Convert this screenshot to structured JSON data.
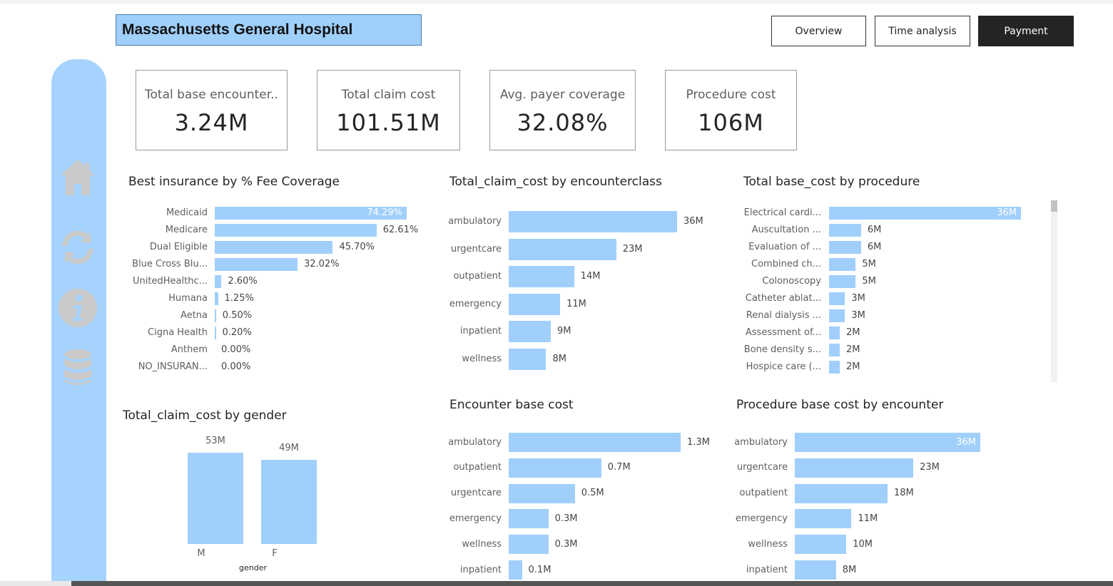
{
  "header": {
    "title": "Massachusetts General Hospital",
    "nav": [
      {
        "label": "Overview",
        "active": false
      },
      {
        "label": "Time analysis",
        "active": false
      },
      {
        "label": "Payment",
        "active": true
      }
    ]
  },
  "sidebar": {
    "icons": [
      "home-icon",
      "refresh-icon",
      "info-icon",
      "database-icon"
    ],
    "color": "#a6d3fd"
  },
  "kpis": [
    {
      "label": "Total base encounter..",
      "value": "3.24M"
    },
    {
      "label": "Total claim cost",
      "value": "101.51M"
    },
    {
      "label": "Avg. payer coverage",
      "value": "32.08%"
    },
    {
      "label": "Procedure cost",
      "value": "106M"
    }
  ],
  "colors": {
    "bar": "#a0cffc",
    "accent": "#9fcffb"
  },
  "chart_data": [
    {
      "id": "insurance",
      "type": "bar",
      "orientation": "horizontal",
      "title": "Best insurance by % Fee Coverage",
      "categories": [
        "Medicaid",
        "Medicare",
        "Dual Eligible",
        "Blue Cross Blu...",
        "UnitedHealthc...",
        "Humana",
        "Aetna",
        "Cigna Health",
        "Anthem",
        "NO_INSURAN..."
      ],
      "values": [
        74.29,
        62.61,
        45.7,
        32.02,
        2.6,
        1.25,
        0.5,
        0.2,
        0.0,
        0.0
      ],
      "labels": [
        "74.29%",
        "62.61%",
        "45.70%",
        "32.02%",
        "2.60%",
        "1.25%",
        "0.50%",
        "0.20%",
        "0.00%",
        "0.00%"
      ],
      "xlim": [
        0,
        74.29
      ]
    },
    {
      "id": "encounterclass",
      "type": "bar",
      "orientation": "horizontal",
      "title": "Total_claim_cost by encounterclass",
      "categories": [
        "ambulatory",
        "urgentcare",
        "outpatient",
        "emergency",
        "inpatient",
        "wellness"
      ],
      "values": [
        36,
        23,
        14,
        11,
        9,
        8
      ],
      "labels": [
        "36M",
        "23M",
        "14M",
        "11M",
        "9M",
        "8M"
      ],
      "xlim": [
        0,
        36
      ]
    },
    {
      "id": "procedure",
      "type": "bar",
      "orientation": "horizontal",
      "title": "Total base_cost by procedure",
      "categories": [
        "Electrical cardi...",
        "Auscultation ...",
        "Evaluation of ...",
        "Combined ch...",
        "Colonoscopy",
        "Catheter ablat...",
        "Renal dialysis ...",
        "Assessment of...",
        "Bone density s...",
        "Hospice care (..."
      ],
      "values": [
        36,
        6,
        6,
        5,
        5,
        3,
        3,
        2,
        2,
        2
      ],
      "labels": [
        "36M",
        "6M",
        "6M",
        "5M",
        "5M",
        "3M",
        "3M",
        "2M",
        "2M",
        "2M"
      ],
      "xlim": [
        0,
        36
      ]
    },
    {
      "id": "gender",
      "type": "bar",
      "orientation": "vertical",
      "title": "Total_claim_cost by gender",
      "categories": [
        "M",
        "F"
      ],
      "values": [
        53,
        49
      ],
      "labels": [
        "53M",
        "49M"
      ],
      "xlabel": "gender",
      "ylim": [
        0,
        53
      ]
    },
    {
      "id": "encounterbase",
      "type": "bar",
      "orientation": "horizontal",
      "title": "Encounter base cost",
      "categories": [
        "ambulatory",
        "outpatient",
        "urgentcare",
        "emergency",
        "wellness",
        "inpatient"
      ],
      "values": [
        1.3,
        0.7,
        0.5,
        0.3,
        0.3,
        0.1
      ],
      "labels": [
        "1.3M",
        "0.7M",
        "0.5M",
        "0.3M",
        "0.3M",
        "0.1M"
      ],
      "xlim": [
        0,
        1.3
      ]
    },
    {
      "id": "procbyenc",
      "type": "bar",
      "orientation": "horizontal",
      "title": "Procedure base cost by encounter",
      "categories": [
        "ambulatory",
        "urgentcare",
        "outpatient",
        "emergency",
        "wellness",
        "inpatient"
      ],
      "values": [
        36,
        23,
        18,
        11,
        10,
        8
      ],
      "labels": [
        "36M",
        "23M",
        "18M",
        "11M",
        "10M",
        "8M"
      ],
      "xlim": [
        0,
        36
      ]
    }
  ]
}
